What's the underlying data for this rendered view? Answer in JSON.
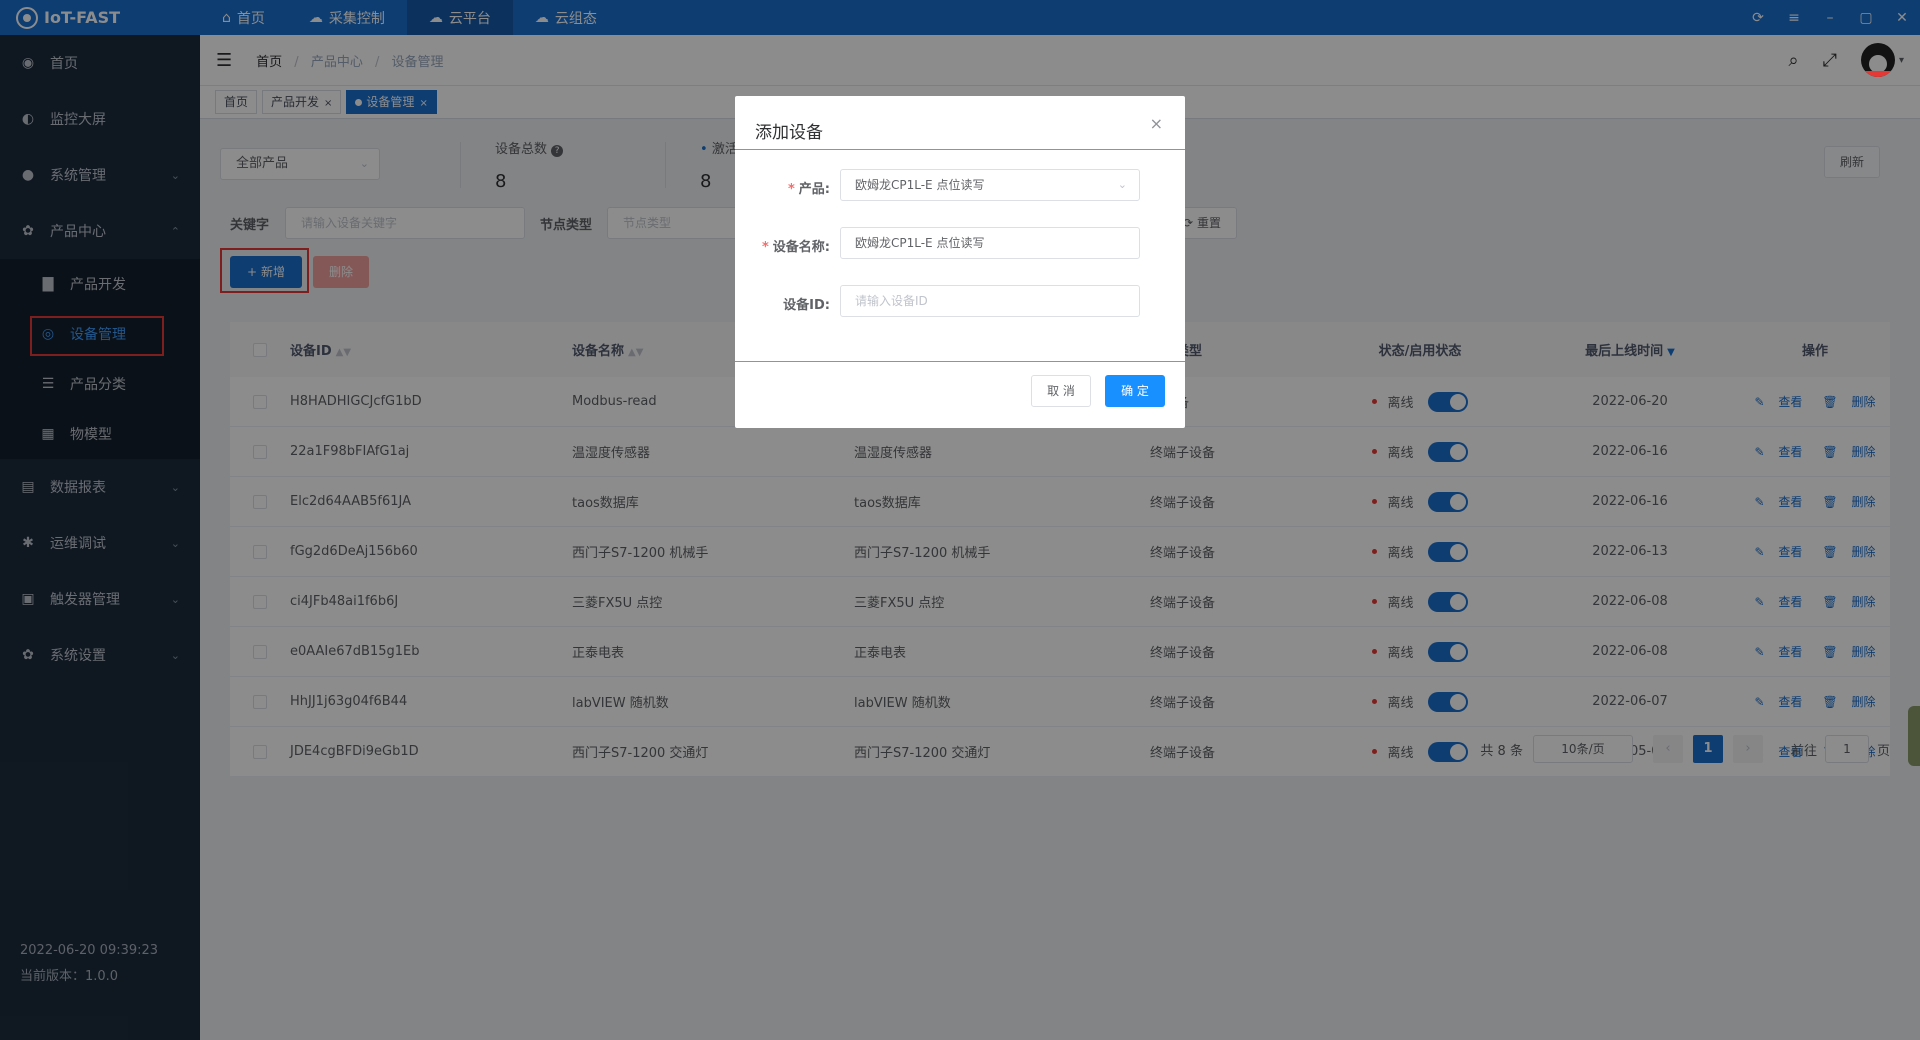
{
  "app": {
    "title": "IoT-FAST"
  },
  "topnav": [
    {
      "icon": "home-icon",
      "glyph": "⌂",
      "label": "首页"
    },
    {
      "icon": "collect-icon",
      "glyph": "☁",
      "label": "采集控制"
    },
    {
      "icon": "cloud-platform-icon",
      "glyph": "☁",
      "label": "云平台"
    },
    {
      "icon": "cloud-config-icon",
      "glyph": "☁",
      "label": "云组态"
    }
  ],
  "sidebar": {
    "items": [
      {
        "label": "首页",
        "icon": "dashboard-icon",
        "glyph": "◉",
        "arrow": ""
      },
      {
        "label": "监控大屏",
        "icon": "globe-icon",
        "glyph": "◐",
        "arrow": ""
      },
      {
        "label": "系统管理",
        "icon": "user-icon",
        "glyph": "●",
        "arrow": "⌄"
      },
      {
        "label": "产品中心",
        "icon": "gear-icon",
        "glyph": "✿",
        "arrow": "⌃"
      }
    ],
    "subitems": [
      {
        "label": "产品开发",
        "icon": "folder-icon",
        "glyph": "▇"
      },
      {
        "label": "设备管理",
        "icon": "device-icon",
        "glyph": "◎"
      },
      {
        "label": "产品分类",
        "icon": "list-icon",
        "glyph": "☰"
      },
      {
        "label": "物模型",
        "icon": "grid-icon",
        "glyph": "▦"
      }
    ],
    "items_after": [
      {
        "label": "数据报表",
        "icon": "report-icon",
        "glyph": "▤",
        "arrow": "⌄"
      },
      {
        "label": "运维调试",
        "icon": "bug-icon",
        "glyph": "✱",
        "arrow": "⌄"
      },
      {
        "label": "触发器管理",
        "icon": "trigger-icon",
        "glyph": "▣",
        "arrow": "⌄"
      },
      {
        "label": "系统设置",
        "icon": "settings-icon",
        "glyph": "✿",
        "arrow": "⌄"
      }
    ],
    "datetime": "2022-06-20 09:39:23",
    "version": "当前版本：1.0.0"
  },
  "breadcrumb": {
    "home": "首页",
    "mid": "产品中心",
    "current": "设备管理"
  },
  "tags": [
    {
      "label": "首页",
      "close": ""
    },
    {
      "label": "产品开发",
      "close": "×"
    },
    {
      "label": "设备管理",
      "close": "×"
    }
  ],
  "filters": {
    "product_select": "全部产品",
    "keyword_label": "关键字",
    "keyword_placeholder": "请输入设备关键字",
    "node_type_label": "节点类型",
    "node_type_placeholder": "节点类型",
    "reset_label": "重置"
  },
  "stats": {
    "total_label": "设备总数",
    "total_value": "8",
    "active_label": "激活",
    "active_value": "8"
  },
  "buttons": {
    "refresh": "刷新",
    "add": "新增",
    "delete": "删除"
  },
  "table": {
    "headers": {
      "id": "设备ID",
      "name": "设备名称",
      "type": "节点类型",
      "status": "状态/启用状态",
      "last_online": "最后上线时间",
      "ops": "操作"
    },
    "rows": [
      {
        "id": "H8HADHIGCJcfG1bD",
        "name": "Modbus-read",
        "product": "",
        "type": "子设备",
        "status": "离线",
        "time": "2022-06-20"
      },
      {
        "id": "22a1F98bFIAfG1aj",
        "name": "温湿度传感器",
        "product": "温湿度传感器",
        "type": "终端子设备",
        "status": "离线",
        "time": "2022-06-16"
      },
      {
        "id": "Elc2d64AAB5f61JA",
        "name": "taos数据库",
        "product": "taos数据库",
        "type": "终端子设备",
        "status": "离线",
        "time": "2022-06-16"
      },
      {
        "id": "fGg2d6DeAj156b60",
        "name": "西门子S7-1200 机械手",
        "product": "西门子S7-1200 机械手",
        "type": "终端子设备",
        "status": "离线",
        "time": "2022-06-13"
      },
      {
        "id": "ci4JFb48ai1f6b6J",
        "name": "三菱FX5U 点控",
        "product": "三菱FX5U 点控",
        "type": "终端子设备",
        "status": "离线",
        "time": "2022-06-08"
      },
      {
        "id": "e0AAIe67dB15g1Eb",
        "name": "正泰电表",
        "product": "正泰电表",
        "type": "终端子设备",
        "status": "离线",
        "time": "2022-06-08"
      },
      {
        "id": "HhJJ1j63g04f6B44",
        "name": "labVIEW 随机数",
        "product": "labVIEW 随机数",
        "type": "终端子设备",
        "status": "离线",
        "time": "2022-06-07"
      },
      {
        "id": "JDE4cgBFDi9eGb1D",
        "name": "西门子S7-1200 交通灯",
        "product": "西门子S7-1200 交通灯",
        "type": "终端子设备",
        "status": "离线",
        "time": "2022-05-05"
      }
    ],
    "op_view": "查看",
    "op_delete": "删除"
  },
  "pager": {
    "total": "共 8 条",
    "size": "10条/页",
    "prev": "‹",
    "page": "1",
    "next": "›",
    "goto": "前往",
    "goto_value": "1",
    "page_suffix": "页"
  },
  "dialog": {
    "title": "添加设备",
    "close": "×",
    "product_label": "产品:",
    "product_value": "欧姆龙CP1L-E 点位读写",
    "name_label": "设备名称:",
    "name_value": "欧姆龙CP1L-E 点位读写",
    "id_label": "设备ID:",
    "id_placeholder": "请输入设备ID",
    "cancel": "取 消",
    "ok": "确 定"
  },
  "colors": {
    "primary": "#1a6fd0",
    "sidebar": "#1d2b3d",
    "highlight": "#e53935"
  }
}
